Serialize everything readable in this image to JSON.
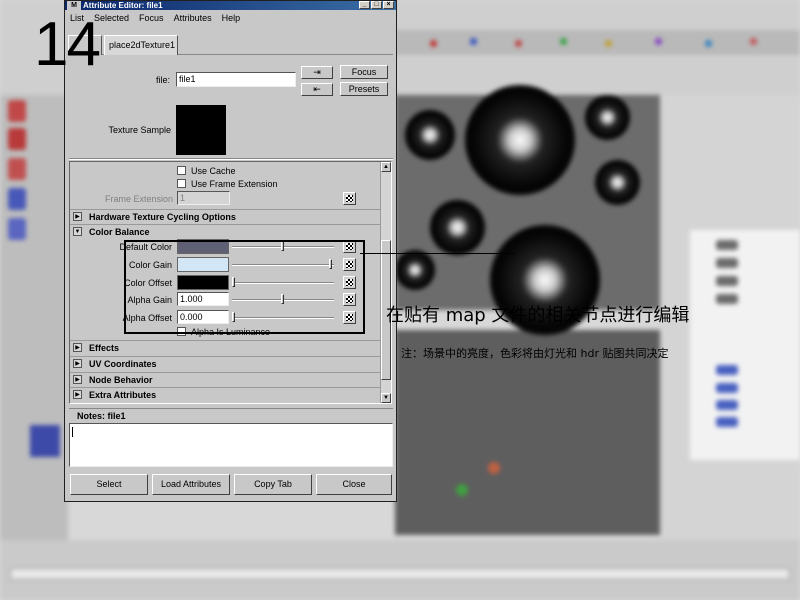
{
  "step_number": "14",
  "window": {
    "title": "Attribute Editor: file1",
    "icon_label": "M",
    "menu": [
      "List",
      "Selected",
      "Focus",
      "Attributes",
      "Help"
    ],
    "tabs": [
      "",
      "place2dTexture1"
    ],
    "file_label": "file:",
    "file_value": "file1",
    "focus_label": "Focus",
    "presets_label": "Presets",
    "texture_sample_label": "Texture Sample"
  },
  "attributes": {
    "use_cache_label": "Use Cache",
    "use_frame_extension_label": "Use Frame Extension",
    "frame_extension_label": "Frame Extension",
    "frame_extension_value": "1",
    "sections": {
      "hardware_texture_cycling": "Hardware Texture Cycling Options",
      "color_balance": "Color Balance",
      "effects": "Effects",
      "uv_coordinates": "UV Coordinates",
      "node_behavior": "Node Behavior",
      "extra_attributes": "Extra Attributes"
    },
    "color_balance": {
      "default_color": {
        "label": "Default Color",
        "swatch": "#5f6074",
        "slider": 0.5
      },
      "color_gain": {
        "label": "Color Gain",
        "swatch": "#d2e6f6",
        "slider": 1.0
      },
      "color_offset": {
        "label": "Color Offset",
        "swatch": "#000000",
        "slider": 0.0
      },
      "alpha_gain": {
        "label": "Alpha Gain",
        "value": "1.000",
        "slider": 0.5
      },
      "alpha_offset": {
        "label": "Alpha Offset",
        "value": "0.000",
        "slider": 0.0
      },
      "alpha_is_luminance_label": "Alpha Is Luminance"
    }
  },
  "notes": {
    "header": "Notes: file1",
    "content": ""
  },
  "buttons": {
    "select": "Select",
    "load_attributes": "Load Attributes",
    "copy_tab": "Copy Tab",
    "close": "Close"
  },
  "annotation": {
    "main": "在贴有 map 文件的相关节点进行编辑",
    "sub": "注：场景中的亮度，色彩将由灯光和 hdr 贴图共同决定"
  }
}
